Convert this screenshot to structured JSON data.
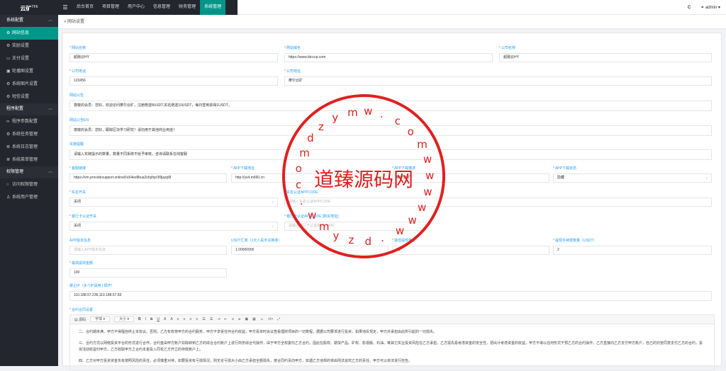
{
  "app": {
    "logo": "云矿",
    "logo_sup": "TF6"
  },
  "nav": {
    "menu_icon": "menu-icon",
    "items": [
      "后台首页",
      "项目管理",
      "用户中心",
      "信息管理",
      "财务管理",
      "系统管理"
    ],
    "active": 5
  },
  "topright": {
    "refresh_icon": "refresh-icon",
    "refresh": "C",
    "user_icon": "user-icon",
    "user": "admin"
  },
  "sidebar": {
    "groups": [
      {
        "label": "系统配置",
        "items": [
          "网站信息",
          "奖励设置",
          "支付设置",
          "轮播图设置",
          "系统图片设置",
          "短信设置"
        ]
      },
      {
        "label": "程序配置",
        "items": [
          "程序参数配置",
          "系统任务管理",
          "系统日志管理",
          "系统菜单管理"
        ]
      },
      {
        "label": "权限管理",
        "items": [
          "访问权限管理",
          "系统用户管理"
        ]
      }
    ]
  },
  "breadcrumb": "网站设置",
  "form": {
    "site_name": {
      "label": "网站名称",
      "value": "超融云HY"
    },
    "site_domain": {
      "label": "网站域名",
      "value": "https://www.btcccp.com"
    },
    "company_name": {
      "label": "公司名称",
      "value": "超融云HY"
    },
    "company_phone": {
      "label": "公司电话",
      "value": "123456"
    },
    "company_address": {
      "label": "公司地址",
      "value": "摩尔云矿"
    },
    "notice": {
      "label": "网站公告",
      "value": "尊敬的会员：您好，欢迎访问摩尔云矿，注册赠送8USDT,实名赠送10USDT，每日签到获得1USDT。"
    },
    "notice_en": {
      "label": "网站公告EN",
      "value": "尊敬的会员：您好，跟踪区块学习研究！请勿用于其他商业用途！"
    },
    "chain_msg": {
      "label": "实链提醒",
      "value": "请输入实链提示的数量，数量不同系统不给予审核，咨询请联系在线客服"
    },
    "service_link": {
      "label": "客服链接",
      "value": "https://vm.providesupport.online/l/u54es8bua2shphpr3l9jazpl8"
    },
    "app_download": {
      "label": "APP下载地址",
      "value": "http://yx4.m660.cn"
    },
    "app_desc": {
      "label": "APP下载描述",
      "value": "摩尔云矿"
    },
    "app_status": {
      "label": "APP下载状态",
      "value": "隐藏"
    },
    "realname_switch": {
      "label": "实名开关",
      "value": "关闭"
    },
    "realname_appcode": {
      "label": "实名认证APPCODE",
      "placeholder": "请输入实名认证APPCODE"
    },
    "bank_switch": {
      "label": "银行卡认证开关",
      "value": "关闭"
    },
    "bank_appcode": {
      "label": "银行卡认证APPCODE",
      "link": "[购买地址]",
      "placeholder": "请输入银行卡认证APPCODE"
    },
    "app_version": {
      "label": "APP版本信息",
      "placeholder": "请输入APP版本信息"
    },
    "usdt_rate": {
      "label": "USDT汇率（1元人民币兑换率）",
      "value": "1.00000000"
    },
    "min_withdraw": {
      "label": "最低提现金额",
      "value": "10"
    },
    "withdraw_fee": {
      "label": "提现手续费数量（USDT）",
      "value": "2"
    },
    "max_withdraw": {
      "label": "最高提现金额",
      "value": "100"
    },
    "forbid_ip": {
      "label": "禁止IP（多个IP请用 | 隔开）",
      "value": "110.188.57.236,110.188.57.83"
    },
    "contract": {
      "label": "合约合同设置",
      "toolbar": {
        "source": "源码",
        "font": "字体",
        "size": "大小",
        "buttons": [
          "B",
          "I",
          "S",
          "U",
          "A",
          "A"
        ]
      },
      "paragraphs": [
        "二、合约期未满，甲方不得擅自终止本协议。否则，乙方有权将甲方的合约服务、甲方不享受任何合约收益，甲方投资时会议查看理财项目的一切章程，据据公司要求进行投资，如果违反规定，甲方并承担由此所引起的一切损失。",
        "三、合约方式以网络投资平台的形式进行合作，合约金由甲方账户扣除转到乙方的综合合约账户上进行商务综合代操作，由于甲方全权委托乙方合约，因此在股权、期货产品、矿权、影视版、石油、等其它实业投资风险在乙方承担，乙方需先看考虑资金的安全性，把出计考虑资金的收益，甲方不得以任何形式干预乙方的合约操作，乙方直接向乙方支付甲方账户，自己的托管同意支付乙方的合约，投资活动收益归甲方，乙方收取甲方之合约本金投入同花乙方开立的存款账户上。",
        "四、乙方对甲方投资资金负有按照风险的责任，必须慎重对待，如要投资有亏损情况，则无论亏损大小由乙方承担全额损失，按合同约责向甲方，如遇乙方违规的将由刑法追究乙方的责任，甲方可以依法进行控告。"
      ]
    }
  },
  "watermark": {
    "text": "道臻源码网",
    "ring": [
      "d",
      "z",
      "y",
      "m",
      "w",
      ".",
      "c",
      "o",
      "m",
      "w",
      "w",
      "w",
      "w",
      "w",
      "w",
      ".",
      "d",
      "z",
      "y",
      "m",
      "w",
      ".",
      "c",
      "o",
      "m"
    ]
  }
}
